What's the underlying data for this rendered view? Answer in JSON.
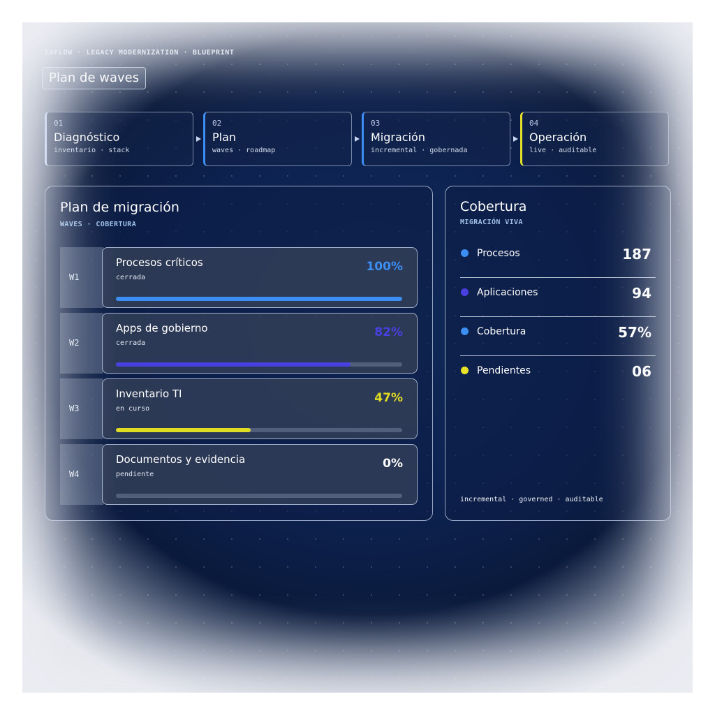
{
  "header": {
    "eyebrow": "EAFLOW · LEGACY MODERNIZATION · BLUEPRINT",
    "title": "Plan de waves"
  },
  "stages": [
    {
      "num": "01",
      "name": "Diagnóstico",
      "sub": "inventario · stack",
      "accent": "#b8cdf7"
    },
    {
      "num": "02",
      "name": "Plan",
      "sub": "waves · roadmap",
      "accent": "#3d8ef2"
    },
    {
      "num": "03",
      "name": "Migración",
      "sub": "incremental · gobernada",
      "accent": "#3d8ef2"
    },
    {
      "num": "04",
      "name": "Operación",
      "sub": "live · auditable",
      "accent": "#e8e22a"
    }
  ],
  "plan": {
    "title": "Plan de migración",
    "subtitle": "WAVES · COBERTURA",
    "waves": [
      {
        "id": "W1",
        "name": "Procesos críticos",
        "status": "cerrada",
        "percent_label": "100%",
        "progress": 1.0,
        "color": "#3d8ef2"
      },
      {
        "id": "W2",
        "name": "Apps de gobierno",
        "status": "cerrada",
        "percent_label": "82%",
        "progress": 0.82,
        "color": "#4a3fe0"
      },
      {
        "id": "W3",
        "name": "Inventario TI",
        "status": "en curso",
        "percent_label": "47%",
        "progress": 0.47,
        "color": "#e0dc22"
      },
      {
        "id": "W4",
        "name": "Documentos y evidencia",
        "status": "pendiente",
        "percent_label": "0%",
        "progress": 0.0,
        "color": "#ffffff"
      }
    ]
  },
  "coverage": {
    "title": "Cobertura",
    "subtitle": "MIGRACIÓN VIVA",
    "metrics": [
      {
        "label": "Procesos",
        "value": "187",
        "color": "#3d8ef2"
      },
      {
        "label": "Aplicaciones",
        "value": "94",
        "color": "#4a3fe0"
      },
      {
        "label": "Cobertura",
        "value": "57%",
        "color": "#3d8ef2"
      },
      {
        "label": "Pendientes",
        "value": "06",
        "color": "#e8e22a"
      }
    ],
    "footnote": "incremental · governed · auditable"
  }
}
